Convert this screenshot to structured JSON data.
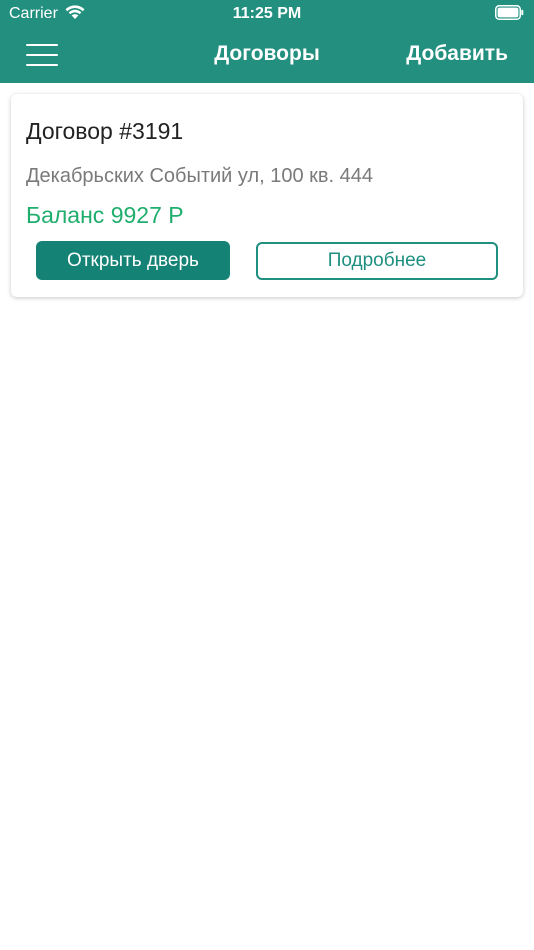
{
  "status_bar": {
    "carrier": "Carrier",
    "time": "11:25 PM"
  },
  "navbar": {
    "title": "Договоры",
    "add_label": "Добавить",
    "background": "#23907f"
  },
  "contracts": [
    {
      "title": "Договор #3191",
      "address": "Декабрьских Событий ул, 100 кв. 444",
      "balance": "Баланс 9927 Р",
      "open_door_label": "Открыть дверь",
      "details_label": "Подробнее"
    }
  ],
  "colors": {
    "accent": "#148274",
    "balance": "#1fae6d"
  }
}
